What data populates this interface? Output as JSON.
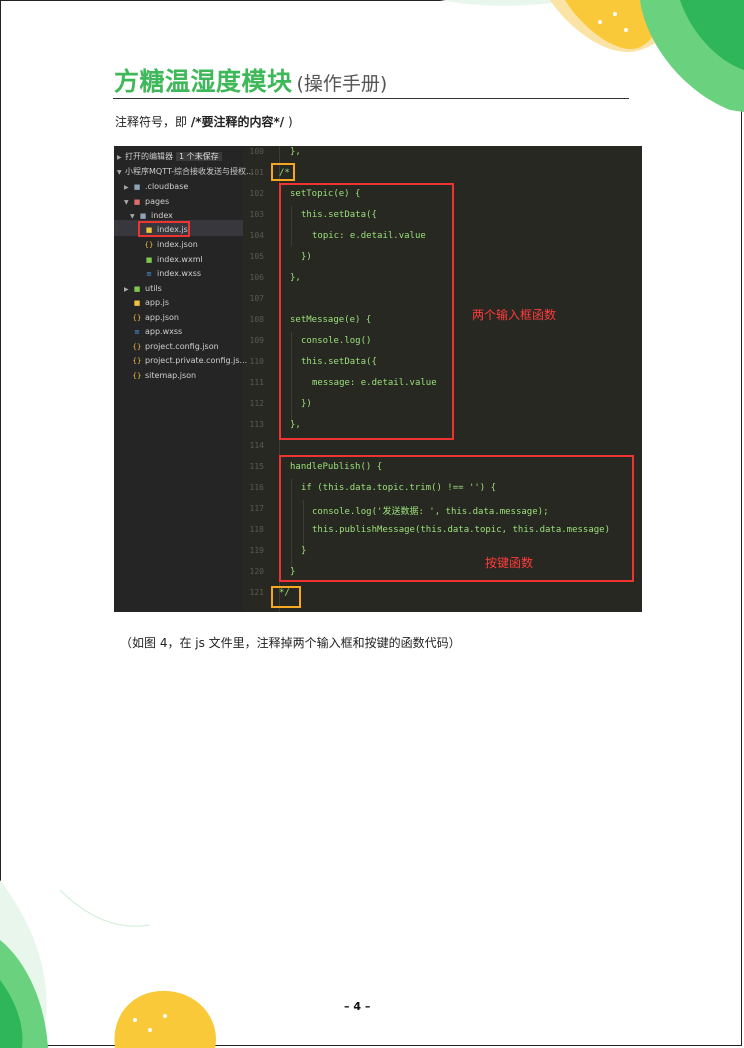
{
  "header": {
    "title": "方糖温湿度模块",
    "subtitle": "(操作手册)"
  },
  "note": {
    "prefix": "注释符号，即 ",
    "symbol": "/*要注释的内容*/",
    "suffix": " )"
  },
  "sidebar": {
    "open_editors": "打开的编辑器",
    "unsaved": "1 个未保存",
    "project": "小程序MQTT-综合接收发送与授权...",
    "items": [
      ".cloudbase",
      "pages",
      "index",
      "index.js",
      "index.json",
      "index.wxml",
      "index.wxss",
      "utils",
      "app.js",
      "app.json",
      "app.wxss",
      "project.config.json",
      "project.private.config.js...",
      "sitemap.json"
    ]
  },
  "code": {
    "line_numbers": [
      "100",
      "101",
      "102",
      "103",
      "104",
      "105",
      "106",
      "107",
      "108",
      "109",
      "110",
      "111",
      "112",
      "113",
      "114",
      "115",
      "116",
      "117",
      "118",
      "119",
      "120",
      "121"
    ],
    "lines": [
      "},",
      "/*",
      "setTopic(e) {",
      "this.setData({",
      "topic: e.detail.value",
      "})",
      "},",
      "",
      "setMessage(e) {",
      "console.log()",
      "this.setData({",
      "message: e.detail.value",
      "})",
      "},",
      "",
      "handlePublish() {",
      "if (this.data.topic.trim() !== '') {",
      "console.log('发送数据: ', this.data.message);",
      "this.publishMessage(this.data.topic, this.data.message)",
      "}",
      "}",
      "*/"
    ]
  },
  "annotations": {
    "input_functions": "两个输入框函数",
    "button_function": "按键函数"
  },
  "caption": "（如图 4，在 js 文件里，注释掉两个输入框和按键的函数代码）",
  "page_number": "– 4 –",
  "colors": {
    "title_green": "#3fb85a",
    "annotation_red": "#ff3b3b",
    "box_orange": "#f5a623",
    "code_green": "#9be07a"
  }
}
